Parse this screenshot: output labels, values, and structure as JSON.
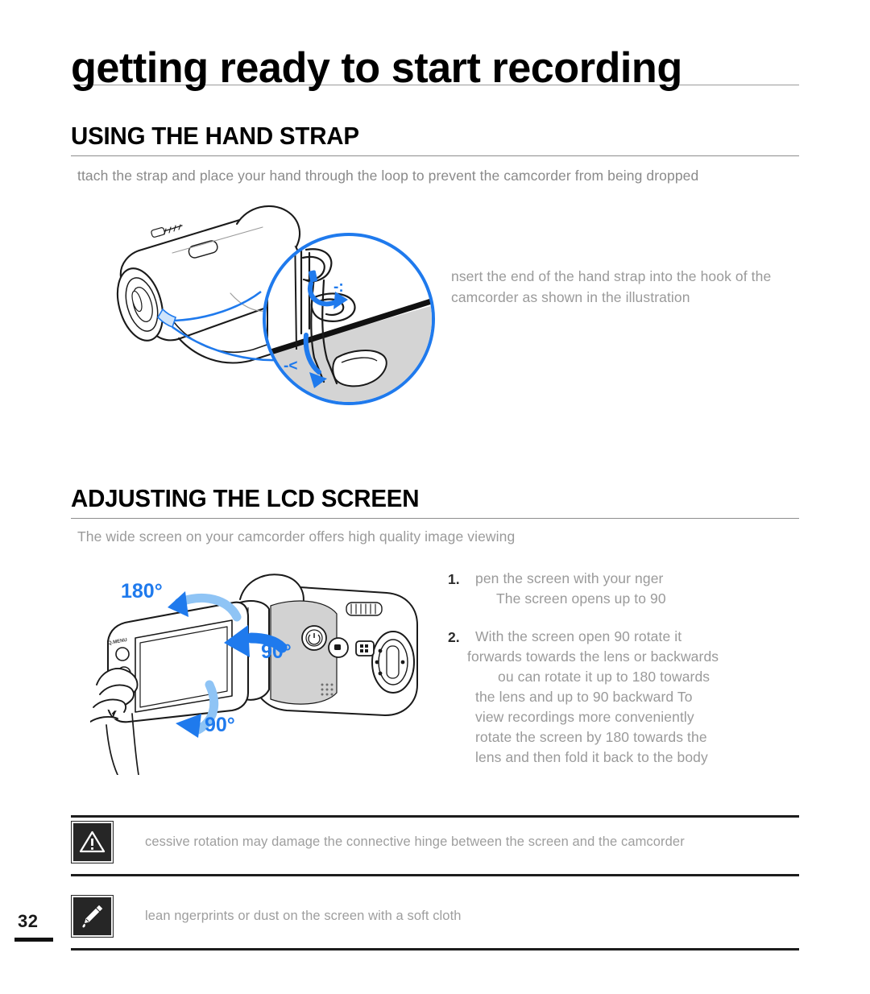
{
  "page": {
    "title": "getting ready to start recording",
    "number": "32"
  },
  "sections": [
    {
      "heading": "USING THE HAND STRAP",
      "intro": "ttach the strap and place your hand through the loop to prevent the camcorder from being dropped",
      "callout": "nsert the end of the hand strap into the hook of the camcorder as shown in the illustration",
      "illustration": {
        "name": "camcorder-hand-strap-illustration",
        "magnifier_label_top": "-:",
        "magnifier_label_bottom": "-<"
      }
    },
    {
      "heading": "ADJUSTING THE LCD SCREEN",
      "intro": "The wide        screen on your camcorder offers high quality image viewing",
      "illustration": {
        "name": "lcd-screen-rotation-illustration",
        "labels": [
          "180°",
          "90°",
          "90°"
        ],
        "button_label": "Q.MENU"
      },
      "steps": [
        {
          "num": "1.",
          "lines": [
            "pen the         screen with your  nger",
            "The screen opens up to 90"
          ]
        },
        {
          "num": "2.",
          "lines": [
            "With the         screen open 90   rotate it",
            "forwards  towards the lens  or backwards",
            "ou can rotate it up to 180   towards",
            "the lens and up to 90   backward  To",
            "view recordings more conveniently",
            "rotate the screen by 180   towards the",
            "lens  and then fold it back to the body"
          ]
        }
      ]
    }
  ],
  "notices": [
    {
      "icon": "warning-triangle-icon",
      "text": "cessive rotation may damage the connective hinge between the screen and the camcorder"
    },
    {
      "icon": "note-pen-icon",
      "text": "lean  ngerprints or dust on the screen with a soft cloth"
    }
  ],
  "colors": {
    "accent_blue": "#1f7aed",
    "accent_blue_light": "#8fc4f5",
    "body_gray": "#9a9a9a",
    "rule_dark": "#1d1d1d"
  }
}
